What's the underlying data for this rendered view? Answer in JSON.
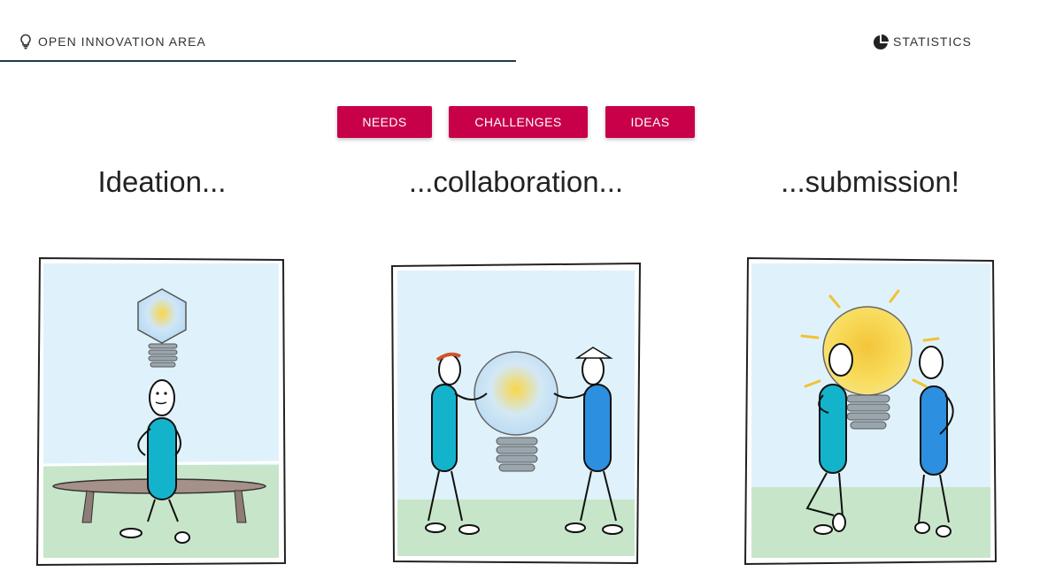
{
  "nav": {
    "open_innovation": {
      "label": "OPEN INNOVATION AREA",
      "icon": "lightbulb-icon"
    },
    "statistics": {
      "label": "STATISTICS",
      "icon": "pie-chart-icon"
    }
  },
  "filters": {
    "needs": "NEEDS",
    "challenges": "CHALLENGES",
    "ideas": "IDEAS"
  },
  "steps": [
    {
      "title": "Ideation...",
      "illustration": "person-thinking-lightbulb"
    },
    {
      "title": "...collaboration...",
      "illustration": "two-people-holding-lightbulb"
    },
    {
      "title": "...submission!",
      "illustration": "two-people-presenting-lightbulb"
    }
  ],
  "colors": {
    "accent": "#c8004a",
    "active_underline": "#1f3a4d",
    "sky": "#dff2fb",
    "grass": "#c7e6c9",
    "teal_person": "#14b3cc",
    "blue_person": "#2d8fe0",
    "bulb_yellow": "#f6d94a"
  }
}
